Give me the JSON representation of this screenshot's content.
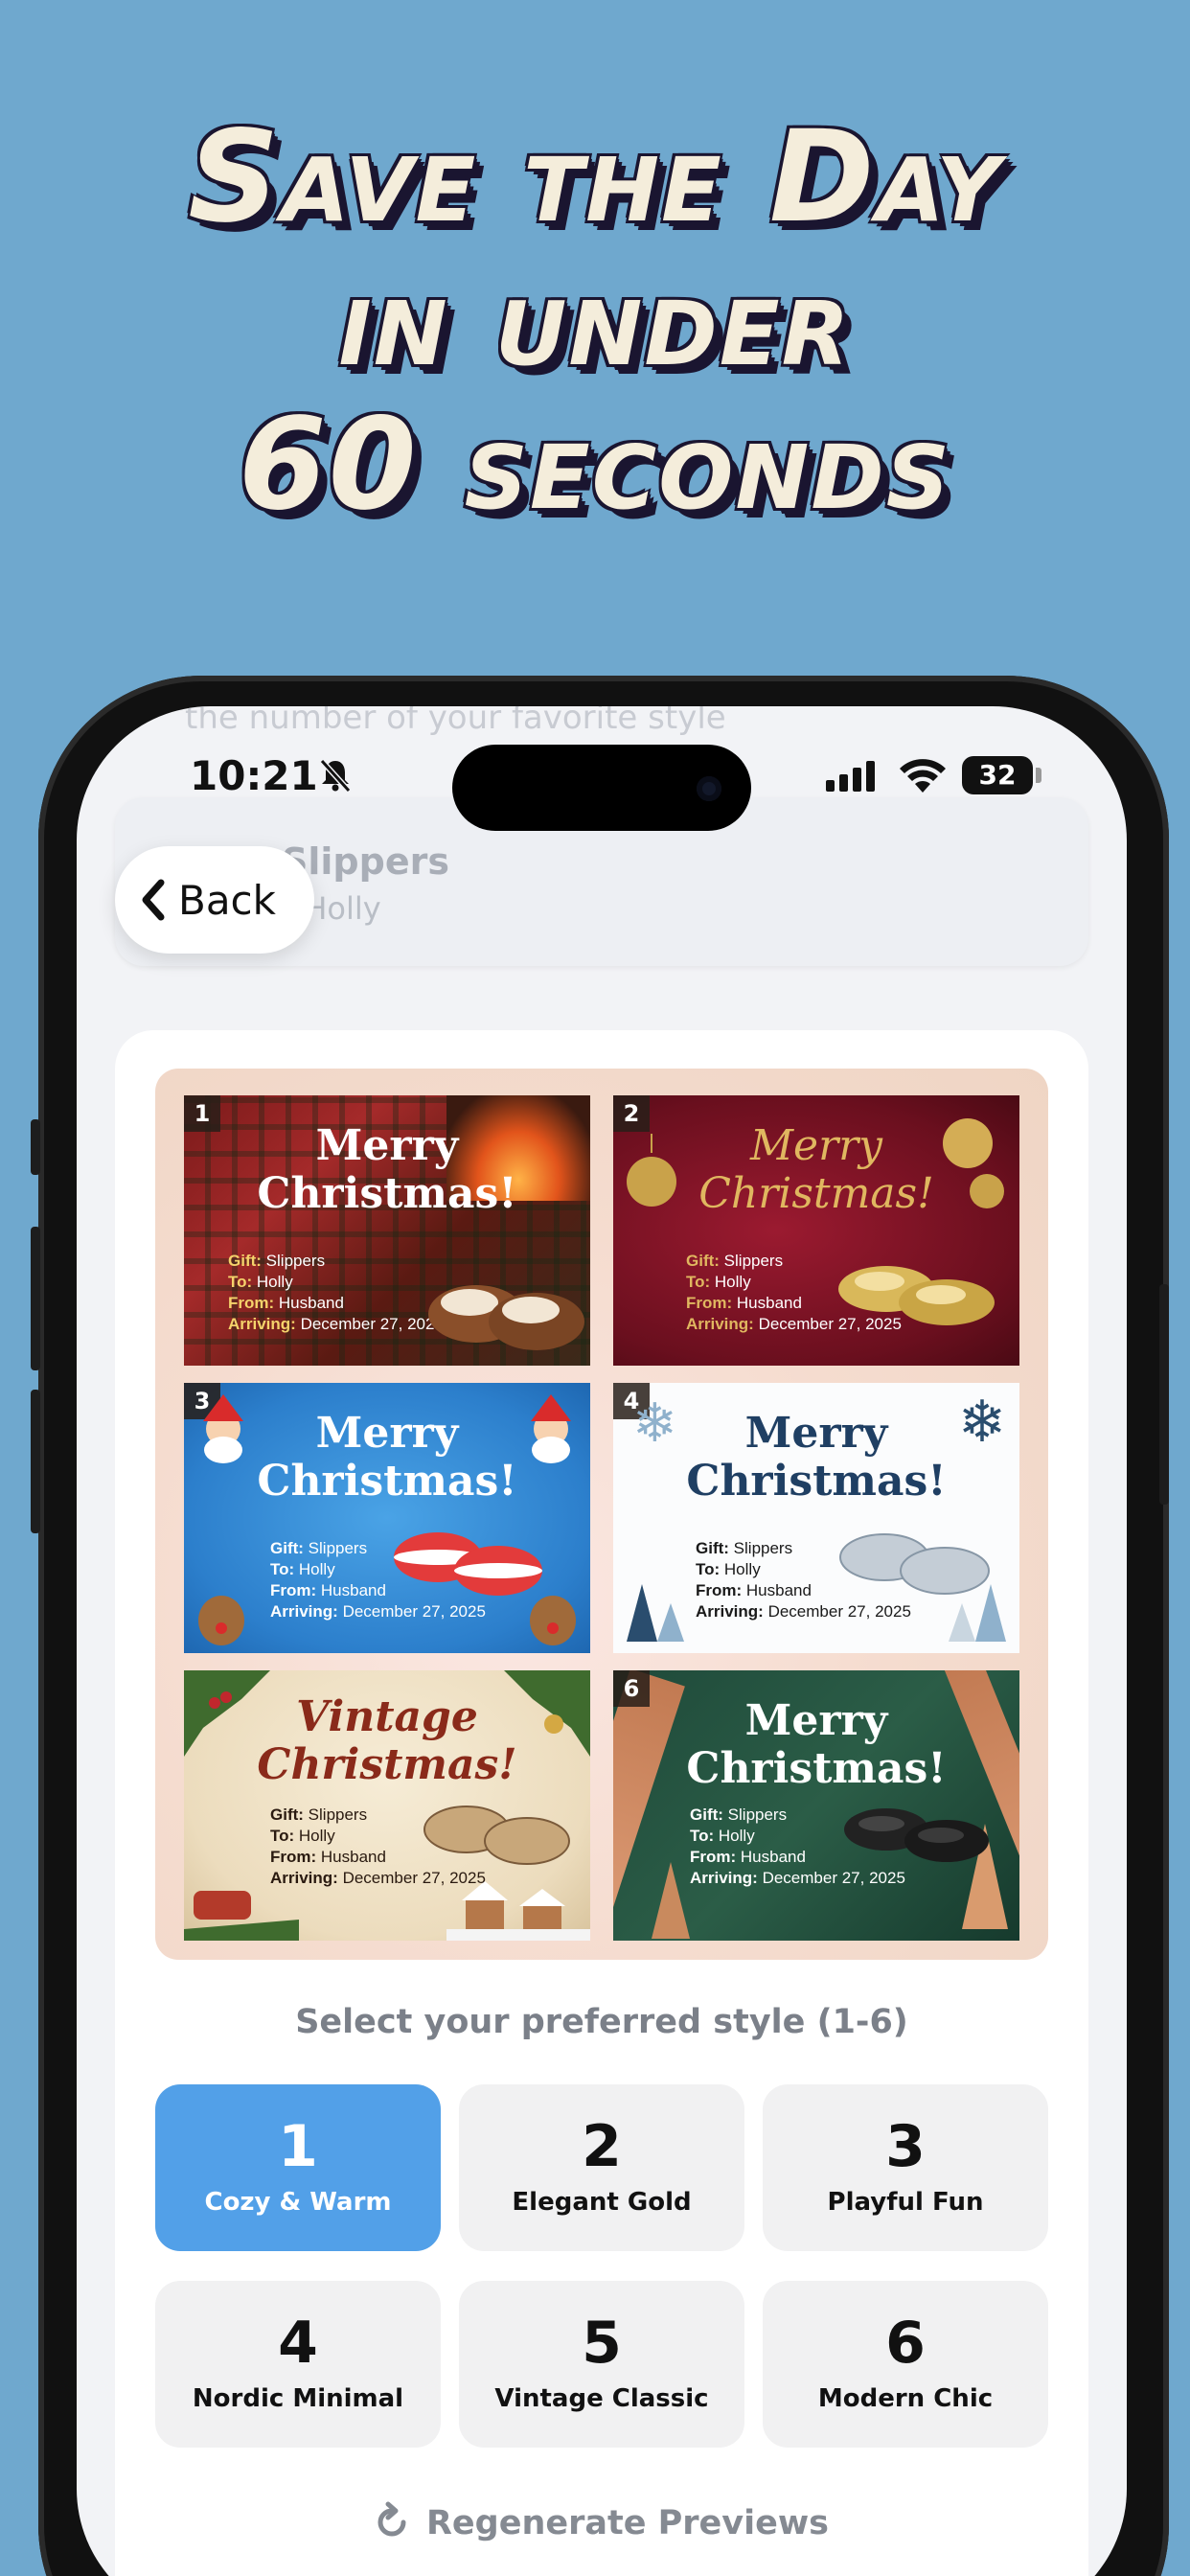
{
  "headline": [
    "Save the Day",
    "in under",
    "60 seconds"
  ],
  "status_bar": {
    "time": "10:21",
    "battery": "32"
  },
  "header": {
    "hint": "the number of your favorite style",
    "title": "Slippers",
    "subtitle": "r Holly"
  },
  "back": {
    "label": "Back"
  },
  "previews": [
    {
      "num": "1",
      "title": "Merry Christmas!",
      "gift_label": "Gift:",
      "gift": "Slippers",
      "to_label": "To:",
      "to": "Holly",
      "from_label": "From:",
      "from": "Husband",
      "arriving_label": "Arriving:",
      "arriving": "December 27, 2025"
    },
    {
      "num": "2",
      "title": "Merry Christmas!",
      "gift_label": "Gift:",
      "gift": "Slippers",
      "to_label": "To:",
      "to": "Holly",
      "from_label": "From:",
      "from": "Husband",
      "arriving_label": "Arriving:",
      "arriving": "December 27, 2025"
    },
    {
      "num": "3",
      "title": "Merry Christmas!",
      "gift_label": "Gift:",
      "gift": "Slippers",
      "to_label": "To:",
      "to": "Holly",
      "from_label": "From:",
      "from": "Husband",
      "arriving_label": "Arriving:",
      "arriving": "December 27, 2025"
    },
    {
      "num": "4",
      "title": "Merry Christmas!",
      "gift_label": "Gift:",
      "gift": "Slippers",
      "to_label": "To:",
      "to": "Holly",
      "from_label": "From:",
      "from": "Husband",
      "arriving_label": "Arriving:",
      "arriving": "December 27, 2025"
    },
    {
      "num": "5",
      "title": "Vintage Christmas!",
      "gift_label": "Gift:",
      "gift": "Slippers",
      "to_label": "To:",
      "to": "Holly",
      "from_label": "From:",
      "from": "Husband",
      "arriving_label": "Arriving:",
      "arriving": "December 27, 2025"
    },
    {
      "num": "6",
      "title": "Merry Christmas!",
      "gift_label": "Gift:",
      "gift": "Slippers",
      "to_label": "To:",
      "to": "Holly",
      "from_label": "From:",
      "from": "Husband",
      "arriving_label": "Arriving:",
      "arriving": "December 27, 2025"
    }
  ],
  "select_label": "Select your preferred style (1-6)",
  "styles": [
    {
      "num": "1",
      "name": "Cozy & Warm",
      "selected": true
    },
    {
      "num": "2",
      "name": "Elegant Gold",
      "selected": false
    },
    {
      "num": "3",
      "name": "Playful Fun",
      "selected": false
    },
    {
      "num": "4",
      "name": "Nordic Minimal",
      "selected": false
    },
    {
      "num": "5",
      "name": "Vintage Classic",
      "selected": false
    },
    {
      "num": "6",
      "name": "Modern Chic",
      "selected": false
    }
  ],
  "regenerate_label": "Regenerate Previews",
  "colors": {
    "background": "#6FA8CE",
    "selected": "#52A0E8",
    "headline": "#F4EDDB"
  }
}
